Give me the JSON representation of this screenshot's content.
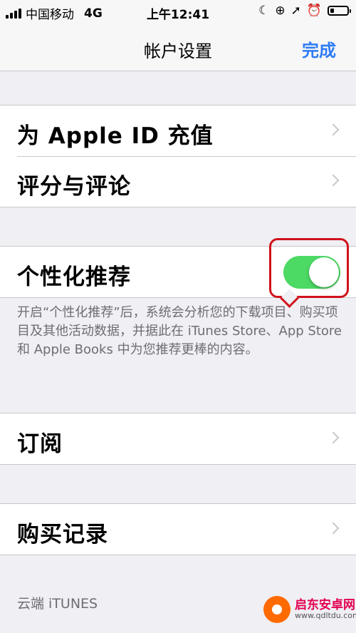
{
  "status_bar": {
    "carrier": "中国移动",
    "network": "4G",
    "time": "上午12:41",
    "icons": [
      "moon-icon",
      "orientation-lock-icon",
      "location-icon",
      "alarm-icon",
      "battery-icon"
    ]
  },
  "nav": {
    "title": "帐户设置",
    "done_label": "完成"
  },
  "group1": [
    {
      "label": "为 Apple ID 充值"
    },
    {
      "label": "评分与评论"
    }
  ],
  "personalization": {
    "label": "个性化推荐",
    "toggle_on": true,
    "toggle_color": "#4cd964",
    "highlight_color": "#d0121b",
    "footer": "开启“个性化推荐”后，系统会分析您的下载项目、购买项目及其他活动数据，并据此在 iTunes Store、App Store 和 Apple Books 中为您推荐更棒的内容。"
  },
  "subscriptions": {
    "label": "订阅"
  },
  "purchase_history": {
    "label": "购买记录"
  },
  "cloud_section": {
    "header": "云端 iTUNES"
  },
  "watermark": {
    "name": "启东安卓网",
    "url": "www.qdltdu.com"
  },
  "colors": {
    "accent": "#2e7cf6",
    "background": "#efeff4"
  }
}
